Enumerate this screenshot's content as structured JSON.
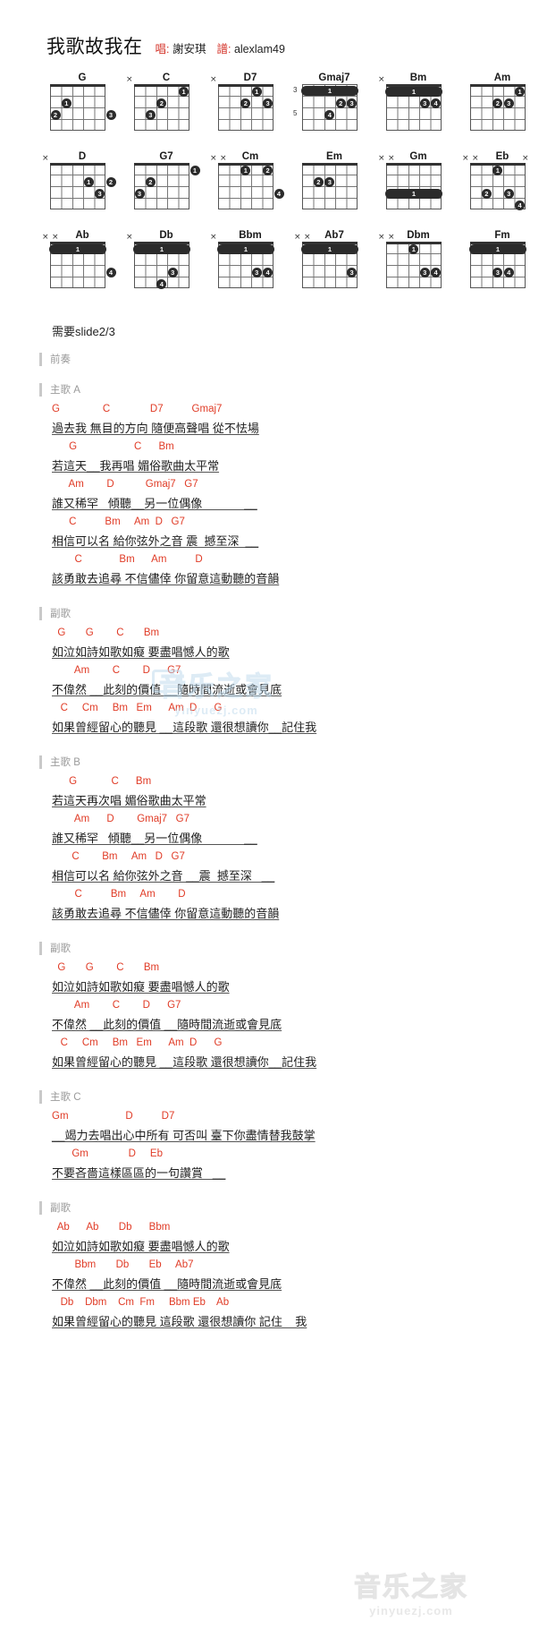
{
  "header": {
    "title": "我歌故我在",
    "singer_label": "唱:",
    "singer": "謝安琪",
    "tab_label": "譜:",
    "tab_author": "alexlam49"
  },
  "note": "需要slide2/3",
  "chords": [
    [
      {
        "name": "G",
        "muted": "",
        "dots": [
          {
            "s": 5,
            "f": 2,
            "n": "1"
          },
          {
            "s": 6,
            "f": 3,
            "n": "2"
          },
          {
            "s": 1,
            "f": 3,
            "n": "3"
          }
        ]
      },
      {
        "name": "C",
        "muted": "x....",
        "dots": [
          {
            "s": 2,
            "f": 1,
            "n": "1"
          },
          {
            "s": 4,
            "f": 2,
            "n": "2"
          },
          {
            "s": 5,
            "f": 3,
            "n": "3"
          }
        ]
      },
      {
        "name": "D7",
        "muted": "x....",
        "dots": [
          {
            "s": 3,
            "f": 1,
            "n": "1"
          },
          {
            "s": 4,
            "f": 2,
            "n": "2"
          },
          {
            "s": 2,
            "f": 2,
            "n": "3"
          }
        ]
      },
      {
        "name": "Gmaj7",
        "muted": "",
        "barre": {
          "fret": 1,
          "n": "1"
        },
        "fretnum": "3",
        "fretnum2": "5",
        "dots": [
          {
            "s": 3,
            "f": 2,
            "n": "2"
          },
          {
            "s": 2,
            "f": 2,
            "n": "3"
          },
          {
            "s": 4,
            "f": 3,
            "n": "4"
          }
        ]
      },
      {
        "name": "Bm",
        "muted": "x",
        "barre": {
          "fret": 1,
          "n": "1"
        },
        "dots": [
          {
            "s": 3,
            "f": 2,
            "n": "3"
          },
          {
            "s": 2,
            "f": 2,
            "n": "4"
          }
        ]
      },
      {
        "name": "Am",
        "muted": "",
        "dots": [
          {
            "s": 2,
            "f": 1,
            "n": "1"
          },
          {
            "s": 4,
            "f": 2,
            "n": "2"
          },
          {
            "s": 3,
            "f": 2,
            "n": "3"
          }
        ]
      }
    ],
    [
      {
        "name": "D",
        "muted": "x",
        "dots": [
          {
            "s": 3,
            "f": 2,
            "n": "1"
          },
          {
            "s": 1,
            "f": 2,
            "n": "2"
          },
          {
            "s": 2,
            "f": 3,
            "n": "3"
          }
        ]
      },
      {
        "name": "G7",
        "muted": "",
        "dots": [
          {
            "s": 1,
            "f": 1,
            "n": "1"
          },
          {
            "s": 5,
            "f": 2,
            "n": "2"
          },
          {
            "s": 6,
            "f": 3,
            "n": "3"
          }
        ]
      },
      {
        "name": "Cm",
        "muted": "xx",
        "dots": [
          {
            "s": 4,
            "f": 1,
            "n": "1"
          },
          {
            "s": 2,
            "f": 1,
            "n": "2"
          },
          {
            "s": 1,
            "f": 3,
            "n": "4"
          }
        ]
      },
      {
        "name": "Em",
        "muted": "",
        "dots": [
          {
            "s": 5,
            "f": 2,
            "n": "2"
          },
          {
            "s": 4,
            "f": 2,
            "n": "3"
          }
        ]
      },
      {
        "name": "Gm",
        "muted": "xx",
        "barre": {
          "fret": 3,
          "n": "1"
        },
        "dots": []
      },
      {
        "name": "Eb",
        "muted": "x...x",
        "dots": [
          {
            "s": 4,
            "f": 1,
            "n": "1"
          },
          {
            "s": 5,
            "f": 3,
            "n": "2"
          },
          {
            "s": 3,
            "f": 3,
            "n": "3"
          },
          {
            "s": 2,
            "f": 4,
            "n": "4"
          }
        ]
      }
    ],
    [
      {
        "name": "Ab",
        "muted": "xx",
        "barre": {
          "fret": 1,
          "n": "1"
        },
        "dots": [
          {
            "s": 1,
            "f": 3,
            "n": "4"
          }
        ]
      },
      {
        "name": "Db",
        "muted": "x",
        "barre": {
          "fret": 1,
          "n": "1"
        },
        "dots": [
          {
            "s": 3,
            "f": 3,
            "n": "3"
          },
          {
            "s": 4,
            "f": 4,
            "n": "4"
          }
        ]
      },
      {
        "name": "Bbm",
        "muted": "x",
        "barre": {
          "fret": 1,
          "n": "1"
        },
        "dots": [
          {
            "s": 3,
            "f": 3,
            "n": "3"
          },
          {
            "s": 2,
            "f": 3,
            "n": "4"
          }
        ]
      },
      {
        "name": "Ab7",
        "muted": "xx",
        "barre": {
          "fret": 1,
          "n": "1"
        },
        "dots": [
          {
            "s": 2,
            "f": 3,
            "n": "3"
          }
        ]
      },
      {
        "name": "Dbm",
        "muted": "xx",
        "dots": [
          {
            "s": 4,
            "f": 1,
            "n": "1"
          },
          {
            "s": 3,
            "f": 3,
            "n": "3"
          },
          {
            "s": 2,
            "f": 3,
            "n": "4"
          }
        ]
      },
      {
        "name": "Fm",
        "muted": "",
        "barre": {
          "fret": 1,
          "n": "1"
        },
        "dots": [
          {
            "s": 4,
            "f": 3,
            "n": "3"
          },
          {
            "s": 3,
            "f": 3,
            "n": "4"
          }
        ]
      }
    ]
  ],
  "sections": [
    {
      "tag": "前奏",
      "lines": []
    },
    {
      "tag": "主歌 A",
      "lines": [
        {
          "chords": "G               C              D7          Gmaj7",
          "lyric": "過去我 無目的方向 隨便高聲唱 從不怯場"
        },
        {
          "chords": "      G                    C      Bm",
          "lyric": "若這天__我再唱 媚俗歌曲太平常"
        },
        {
          "chords": "      Am        D           Gmaj7   G7",
          "lyric": "誰又稀罕   傾聽__另一位偶像             __"
        },
        {
          "chords": "      C          Bm     Am  D   G7",
          "lyric": "相信可以名 給你弦外之音 震  撼至深  __"
        },
        {
          "chords": "        C             Bm      Am          D",
          "lyric": "該勇敢去追尋 不信儘倖 你留意這動聽的音韻"
        }
      ]
    },
    {
      "tag": "副歌",
      "lines": [
        {
          "chords": "  G       G        C       Bm",
          "lyric": "如泣如詩如歌如癡 要盡唱憾人的歌"
        },
        {
          "chords": "        Am        C        D      G7",
          "lyric": "不偉然 __此刻的價值 __隨時間流逝或會見底"
        },
        {
          "chords": "   C     Cm     Bm   Em      Am  D      G",
          "lyric": "如果曾經留心的聽見 __這段歌 還很想讀你__記住我"
        }
      ]
    },
    {
      "tag": "主歌 B",
      "lines": [
        {
          "chords": "      G            C      Bm",
          "lyric": "若這天再次唱 媚俗歌曲太平常"
        },
        {
          "chords": "        Am      D        Gmaj7   G7",
          "lyric": "誰又稀罕   傾聽__另一位偶像             __"
        },
        {
          "chords": "       C        Bm     Am   D   G7",
          "lyric": "相信可以名 給你弦外之音 __震  撼至深   __"
        },
        {
          "chords": "        C          Bm     Am        D",
          "lyric": "該勇敢去追尋 不信儘倖 你留意這動聽的音韻"
        }
      ]
    },
    {
      "tag": "副歌",
      "lines": [
        {
          "chords": "  G       G        C       Bm",
          "lyric": "如泣如詩如歌如癡 要盡唱憾人的歌"
        },
        {
          "chords": "        Am        C        D      G7",
          "lyric": "不偉然 __此刻的價值 __隨時間流逝或會見底"
        },
        {
          "chords": "   C     Cm     Bm   Em      Am  D      G",
          "lyric": "如果曾經留心的聽見 __這段歌 還很想讀你__記住我"
        }
      ]
    },
    {
      "tag": "主歌 C",
      "lines": [
        {
          "chords": "Gm                    D          D7",
          "lyric": "__竭力去唱出心中所有 可否叫 臺下你盡情替我鼓掌"
        },
        {
          "chords": "       Gm              D     Eb",
          "lyric": "不要吝嗇這樣區區的一句讚賞   __"
        }
      ]
    },
    {
      "tag": "副歌",
      "lines": [
        {
          "chords": "  Ab      Ab       Db      Bbm",
          "lyric": "如泣如詩如歌如癡 要盡唱憾人的歌"
        },
        {
          "chords": "        Bbm       Db       Eb     Ab7",
          "lyric": "不偉然 __此刻的價值 __隨時間流逝或會見底"
        },
        {
          "chords": "   Db    Dbm    Cm  Fm     Bbm Eb    Ab",
          "lyric": "如果曾經留心的聽見 這段歌 還很想讀你 記住    我"
        }
      ]
    }
  ],
  "watermark": {
    "text": "音乐之家",
    "domain": "yinyuezj.com"
  }
}
